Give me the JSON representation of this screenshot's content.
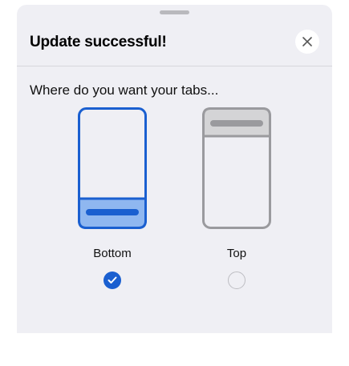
{
  "sheet": {
    "title": "Update successful!",
    "question": "Where do you want your tabs...",
    "close_icon": "close-icon"
  },
  "options": [
    {
      "label": "Bottom",
      "selected": true,
      "icon": "phone-tabs-bottom-icon"
    },
    {
      "label": "Top",
      "selected": false,
      "icon": "phone-tabs-top-icon"
    }
  ],
  "colors": {
    "accent": "#1a5fd0",
    "accent_fill": "#8fb7f0",
    "sheet_bg": "#efeff4",
    "unselected_stroke": "#9a9a9e",
    "unselected_fill": "#d4d4d6"
  }
}
